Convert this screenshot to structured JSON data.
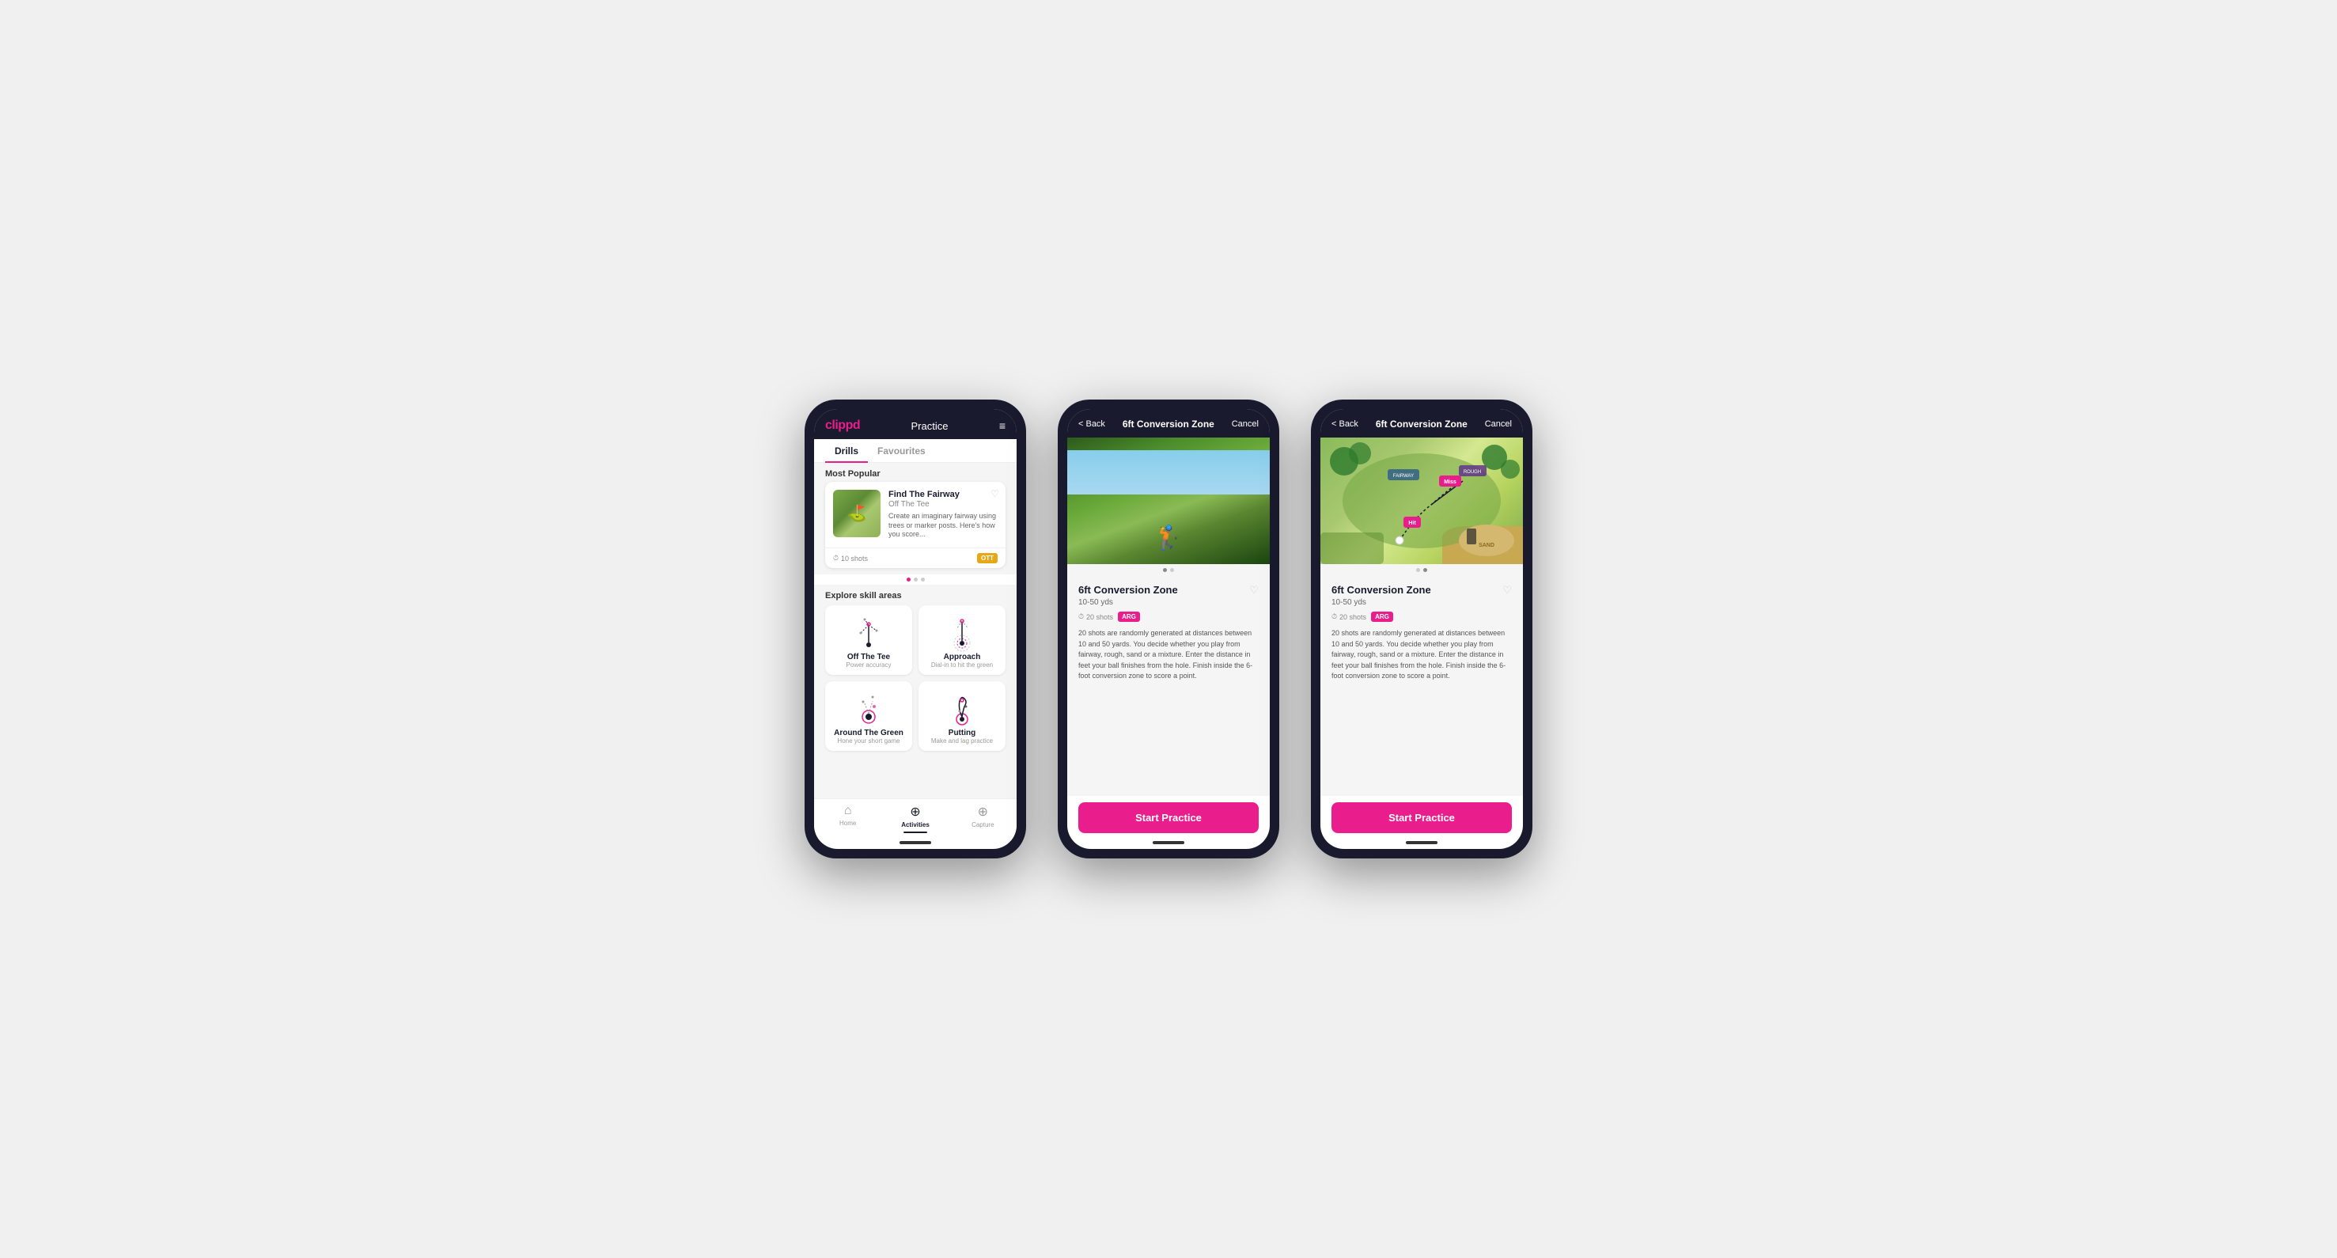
{
  "phone1": {
    "logo": "clippd",
    "header_title": "Practice",
    "menu_icon": "≡",
    "tabs": [
      {
        "label": "Drills",
        "active": true
      },
      {
        "label": "Favourites",
        "active": false
      }
    ],
    "most_popular_label": "Most Popular",
    "featured_card": {
      "title": "Find The Fairway",
      "subtitle": "Off The Tee",
      "description": "Create an imaginary fairway using trees or marker posts. Here's how you score...",
      "shots": "10 shots",
      "badge": "OTT"
    },
    "explore_label": "Explore skill areas",
    "skills": [
      {
        "title": "Off The Tee",
        "subtitle": "Power accuracy"
      },
      {
        "title": "Approach",
        "subtitle": "Dial-in to hit the green"
      },
      {
        "title": "Around The Green",
        "subtitle": "Hone your short game"
      },
      {
        "title": "Putting",
        "subtitle": "Make and lag practice"
      }
    ],
    "nav": [
      {
        "label": "Home",
        "icon": "⌂",
        "active": false
      },
      {
        "label": "Activities",
        "icon": "⊕",
        "active": true
      },
      {
        "label": "Capture",
        "icon": "⊕",
        "active": false
      }
    ]
  },
  "phone2": {
    "back_label": "< Back",
    "header_title": "6ft Conversion Zone",
    "cancel_label": "Cancel",
    "drill_title": "6ft Conversion Zone",
    "drill_range": "10-50 yds",
    "shots": "20 shots",
    "badge": "ARG",
    "description": "20 shots are randomly generated at distances between 10 and 50 yards. You decide whether you play from fairway, rough, sand or a mixture. Enter the distance in feet your ball finishes from the hole. Finish inside the 6-foot conversion zone to score a point.",
    "start_label": "Start Practice"
  },
  "phone3": {
    "back_label": "< Back",
    "header_title": "6ft Conversion Zone",
    "cancel_label": "Cancel",
    "drill_title": "6ft Conversion Zone",
    "drill_range": "10-50 yds",
    "shots": "20 shots",
    "badge": "ARG",
    "description": "20 shots are randomly generated at distances between 10 and 50 yards. You decide whether you play from fairway, rough, sand or a mixture. Enter the distance in feet your ball finishes from the hole. Finish inside the 6-foot conversion zone to score a point.",
    "start_label": "Start Practice"
  }
}
